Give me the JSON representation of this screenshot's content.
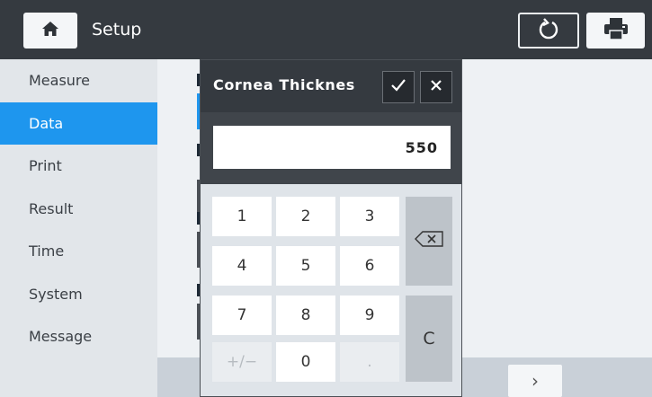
{
  "header": {
    "title": "Setup",
    "home_icon": "home-icon",
    "refresh_icon": "refresh-icon",
    "print_icon": "printer-icon"
  },
  "sidebar": {
    "items": [
      {
        "label": "Measure"
      },
      {
        "label": "Data",
        "active": true
      },
      {
        "label": "Print"
      },
      {
        "label": "Result"
      },
      {
        "label": "Time"
      },
      {
        "label": "System"
      },
      {
        "label": "Message"
      }
    ]
  },
  "dialog": {
    "title": "Cornea Thicknes",
    "ok_icon": "check-icon",
    "close_icon": "close-icon",
    "value": "550",
    "keys": {
      "k1": "1",
      "k2": "2",
      "k3": "3",
      "k4": "4",
      "k5": "5",
      "k6": "6",
      "k7": "7",
      "k8": "8",
      "k9": "9",
      "sign": "+/−",
      "k0": "0",
      "dot": ".",
      "clear": "C"
    },
    "backspace_icon": "backspace-icon"
  },
  "footer": {
    "next_label": "›"
  },
  "colors": {
    "header_bg": "#353a40",
    "active_accent": "#1e96ee",
    "sidebar_bg": "#e2e6ea"
  }
}
